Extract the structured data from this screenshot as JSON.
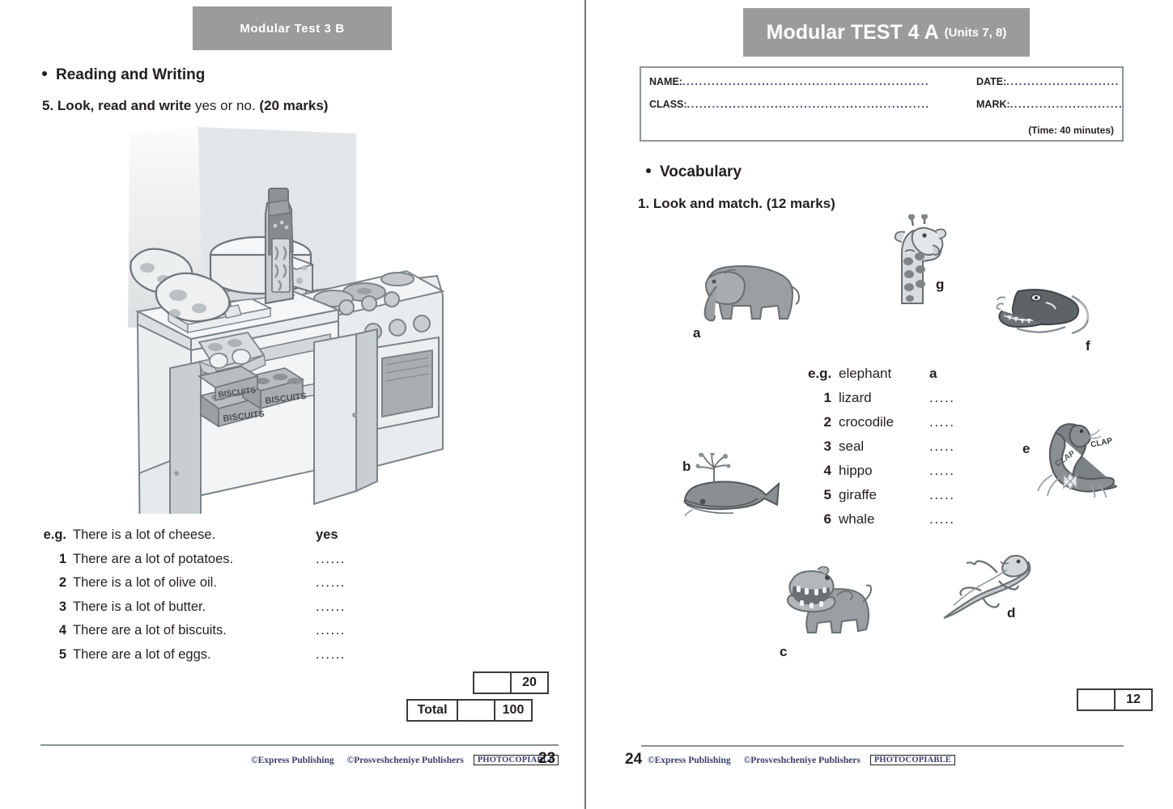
{
  "left_page": {
    "banner_title": "Modular  Test 3 B",
    "section_heading": "Reading and Writing",
    "task": {
      "number": "5.",
      "instruction_bold_1": "Look, read and write",
      "instruction_reg": "yes",
      "instruction_bold_2": "or",
      "instruction_reg_2": "no.",
      "marks": "(20 marks)",
      "full": "5. Look, read and write yes or no. (20 marks)"
    },
    "questions": [
      {
        "num": "e.g.",
        "text": "There is a lot of cheese.",
        "answer": "yes",
        "answered": true
      },
      {
        "num": "1",
        "text": "There are a lot of potatoes.",
        "answer": "......",
        "answered": false
      },
      {
        "num": "2",
        "text": "There is a lot of olive oil.",
        "answer": "......",
        "answered": false
      },
      {
        "num": "3",
        "text": "There is a lot of butter.",
        "answer": "......",
        "answered": false
      },
      {
        "num": "4",
        "text": "There are a lot of biscuits.",
        "answer": "......",
        "answered": false
      },
      {
        "num": "5",
        "text": "There are a lot of eggs.",
        "answer": "......",
        "answered": false
      }
    ],
    "score": {
      "exercise_blank": "",
      "exercise_max": "20",
      "total_label": "Total",
      "total_blank": "",
      "total_max": "100"
    },
    "illustration": {
      "name": "kitchen-food-scene",
      "items_depicted": [
        "potatoes",
        "cheese wheel",
        "olive oil bottle",
        "butter",
        "eggs",
        "biscuits boxes",
        "cooker",
        "cupboard"
      ],
      "box_labels": [
        "BISCUITS",
        "BISCUITS",
        "BISCUITS"
      ]
    },
    "footer": {
      "publisher_1": "©Express Publishing",
      "publisher_2": "©Prosveshcheniye Publishers",
      "photocopiable": "PHOTOCOPIABLE",
      "page_number": "23"
    }
  },
  "right_page": {
    "banner_title": "Modular TEST 4 A",
    "banner_units": "(Units 7, 8)",
    "id_box": {
      "name_label": "NAME:",
      "name_value": "",
      "date_label": "DATE:",
      "date_value": "",
      "class_label": "CLASS:",
      "class_value": "",
      "mark_label": "MARK:",
      "mark_value": "",
      "time_note": "(Time: 40 minutes)"
    },
    "section_heading": "Vocabulary",
    "task": {
      "number": "1.",
      "instruction": "Look and match.",
      "marks": "(12 marks)",
      "full": "1. Look and match. (12 marks)"
    },
    "match_items": [
      {
        "num": "e.g.",
        "word": "elephant",
        "answer": "a",
        "answered": true
      },
      {
        "num": "1",
        "word": "lizard",
        "answer": ".....",
        "answered": false
      },
      {
        "num": "2",
        "word": "crocodile",
        "answer": ".....",
        "answered": false
      },
      {
        "num": "3",
        "word": "seal",
        "answer": ".....",
        "answered": false
      },
      {
        "num": "4",
        "word": "hippo",
        "answer": ".....",
        "answered": false
      },
      {
        "num": "5",
        "word": "giraffe",
        "answer": ".....",
        "answered": false
      },
      {
        "num": "6",
        "word": "whale",
        "answer": ".....",
        "answered": false
      }
    ],
    "pictures": [
      {
        "letter": "a",
        "animal": "elephant"
      },
      {
        "letter": "g",
        "animal": "giraffe"
      },
      {
        "letter": "f",
        "animal": "crocodile"
      },
      {
        "letter": "e",
        "animal": "seal",
        "caption": "CLAP CLAP"
      },
      {
        "letter": "b",
        "animal": "whale"
      },
      {
        "letter": "c",
        "animal": "hippo"
      },
      {
        "letter": "d",
        "animal": "lizard"
      }
    ],
    "score": {
      "exercise_blank": "",
      "exercise_max": "12"
    },
    "footer": {
      "page_number": "24",
      "publisher_1": "©Express Publishing",
      "publisher_2": "©Prosveshcheniye Publishers",
      "photocopiable": "PHOTOCOPIABLE"
    }
  },
  "colors": {
    "banner_bg": "#9b9b9b",
    "text": "#231f20",
    "divider": "#6e7679",
    "footer_rule": "#8c9396",
    "publisher_text": "#3a3f6b",
    "box_border": "#3b3b3b"
  },
  "dots": {
    "long": "....................................................................",
    "short": "............................."
  }
}
